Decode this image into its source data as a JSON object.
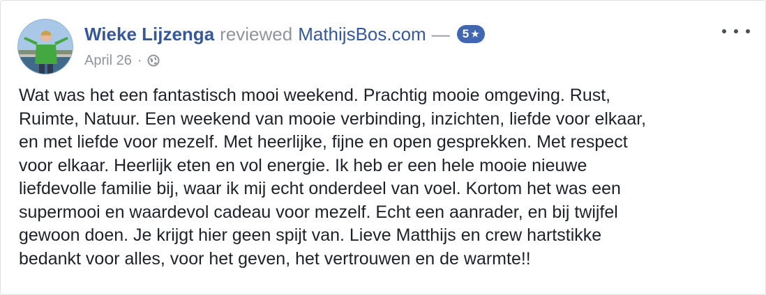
{
  "post": {
    "author": "Wieke Lijzenga",
    "action": "reviewed",
    "page": "MathijsBos.com",
    "dash": "—",
    "rating": "5",
    "rating_star": "★",
    "date": "April 26",
    "meta_separator": "·",
    "privacy_icon": "globe-icon",
    "more_icon": "more-options-icon",
    "review_lines": [
      "Wat was het een fantastisch mooi weekend. Prachtig mooie omgeving. Rust,",
      "Ruimte, Natuur. Een weekend van mooie verbinding, inzichten, liefde voor elkaar,",
      "en met liefde voor mezelf. Met heerlijke, fijne en open gesprekken. Met respect",
      "voor elkaar. Heerlijk eten en vol energie. Ik heb er een hele mooie nieuwe",
      "liefdevolle familie bij, waar ik mij echt onderdeel van voel. Kortom het was een",
      "supermooi en waardevol cadeau voor mezelf. Echt een aanrader, en bij twijfel",
      "gewoon doen. Je krijgt hier geen spijt van. Lieve Matthijs en crew hartstikke",
      "bedankt voor alles, voor het geven, het vertrouwen en de warmte!!"
    ]
  },
  "colors": {
    "link": "#365899",
    "secondary_text": "#90949c",
    "badge": "#4267b2",
    "body_text": "#1d2129",
    "border": "#dddfe2"
  }
}
